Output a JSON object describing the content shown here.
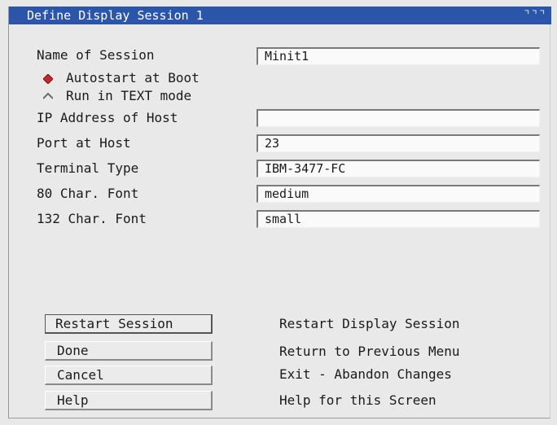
{
  "window": {
    "title": "Define Display Session 1",
    "title_icons": "⌝⌝⌝"
  },
  "form": {
    "name_label": "Name of Session",
    "name_value": "Minit1",
    "radio_autostart": "Autostart at Boot",
    "radio_text_mode": "Run in TEXT mode",
    "ip_label": "IP Address of Host",
    "ip_value": "",
    "port_label": "Port at Host",
    "port_value": "23",
    "terminal_label": "Terminal Type",
    "terminal_value": "IBM-3477-FC",
    "font80_label": "80 Char. Font",
    "font80_value": "medium",
    "font132_label": "132 Char. Font",
    "font132_value": "small"
  },
  "buttons": [
    {
      "label": "Restart Session",
      "desc": "Restart Display Session"
    },
    {
      "label": "Done",
      "desc": "Return to Previous Menu"
    },
    {
      "label": "Cancel",
      "desc": "Exit - Abandon Changes"
    },
    {
      "label": "Help",
      "desc": "Help for this Screen"
    }
  ],
  "colors": {
    "titlebar": "#2a55a8",
    "radio_selected": "#c0282d",
    "background": "#e9e9e9"
  },
  "icons": {
    "radio_selected": "diamond-filled-icon",
    "radio_unselected": "diamond-hollow-icon"
  }
}
